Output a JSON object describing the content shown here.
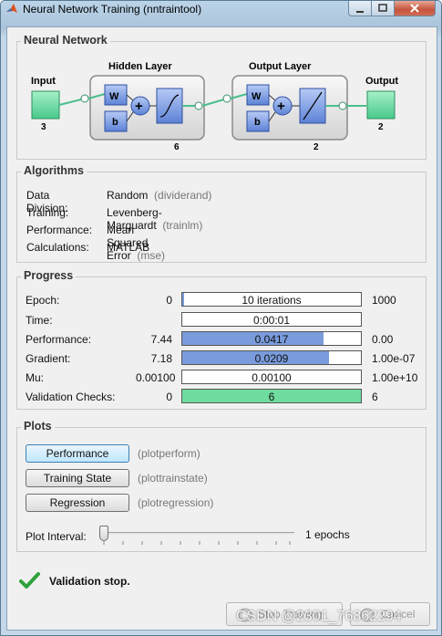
{
  "window": {
    "title": "Neural Network Training (nntraintool)"
  },
  "network": {
    "section_title": "Neural Network",
    "input_label": "Input",
    "input_size": "3",
    "hidden_label": "Hidden Layer",
    "hidden_size": "6",
    "output_layer_label": "Output Layer",
    "output_layer_size": "2",
    "output_label": "Output",
    "output_size": "2",
    "weight_symbol": "W",
    "bias_symbol": "b",
    "sum_symbol": "+"
  },
  "algorithms": {
    "section_title": "Algorithms",
    "rows": [
      {
        "label": "Data Division:",
        "value": "Random",
        "func": "(dividerand)"
      },
      {
        "label": "Training:",
        "value": "Levenberg-Marquardt",
        "func": "(trainlm)"
      },
      {
        "label": "Performance:",
        "value": "Mean Squared Error",
        "func": "(mse)"
      },
      {
        "label": "Calculations:",
        "value": "MATLAB",
        "func": ""
      }
    ]
  },
  "progress": {
    "section_title": "Progress",
    "rows": [
      {
        "label": "Epoch:",
        "min": "0",
        "current": "10 iterations",
        "max": "1000",
        "fill": 0.01,
        "color": "#7a9bdc"
      },
      {
        "label": "Time:",
        "min": "",
        "current": "0:00:01",
        "max": "",
        "fill": 0,
        "color": "#7a9bdc"
      },
      {
        "label": "Performance:",
        "min": "7.44",
        "current": "0.0417",
        "max": "0.00",
        "fill": 0.79,
        "color": "#7a9bdc"
      },
      {
        "label": "Gradient:",
        "min": "7.18",
        "current": "0.0209",
        "max": "1.00e-07",
        "fill": 0.82,
        "color": "#7a9bdc"
      },
      {
        "label": "Mu:",
        "min": "0.00100",
        "current": "0.00100",
        "max": "1.00e+10",
        "fill": 0,
        "color": "#7a9bdc"
      },
      {
        "label": "Validation Checks:",
        "min": "0",
        "current": "6",
        "max": "6",
        "fill": 1.0,
        "color": "#6fdc9e"
      }
    ]
  },
  "plots": {
    "section_title": "Plots",
    "buttons": [
      {
        "label": "Performance",
        "func": "(plotperform)"
      },
      {
        "label": "Training State",
        "func": "(plottrainstate)"
      },
      {
        "label": "Regression",
        "func": "(plotregression)"
      }
    ],
    "interval_label": "Plot Interval:",
    "interval_value": "1 epochs",
    "interval_fraction": 0.0
  },
  "status": {
    "message": "Validation stop.",
    "icon": "checkmark-icon"
  },
  "actions": {
    "stop_label": "Stop Training",
    "cancel_label": "Cancel"
  },
  "watermark": "CSDN @2301_76862294"
}
